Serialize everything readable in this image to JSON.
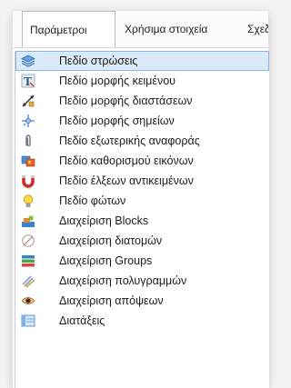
{
  "menubar": {
    "tabs": [
      {
        "label": "Παράμετροι"
      },
      {
        "label": "Χρήσιμα στοιχεία"
      },
      {
        "label": "Σχεδ"
      }
    ]
  },
  "dropdown": {
    "items": [
      {
        "label": "Πεδίο στρώσεις",
        "icon": "layers-icon",
        "selected": true
      },
      {
        "label": "Πεδίο μορφής κειμένου",
        "icon": "text-style-icon"
      },
      {
        "label": "Πεδίο μορφής διαστάσεων",
        "icon": "dimension-style-icon"
      },
      {
        "label": "Πεδίο μορφής σημείων",
        "icon": "point-style-icon"
      },
      {
        "label": "Πεδίο εξωτερικής αναφοράς",
        "icon": "paperclip-icon"
      },
      {
        "label": "Πεδίο καθορισμού εικόνων",
        "icon": "image-icon"
      },
      {
        "label": "Πεδίο έλξεων αντικειμένων",
        "icon": "magnet-icon"
      },
      {
        "label": "Πεδίο φώτων",
        "icon": "lightbulb-icon"
      },
      {
        "label": "Διαχείριση Blocks",
        "icon": "blocks-icon"
      },
      {
        "label": "Διαχείριση διατομών",
        "icon": "section-icon"
      },
      {
        "label": "Διαχείριση Groups",
        "icon": "groups-icon"
      },
      {
        "label": "Διαχείριση πολυγραμμών",
        "icon": "polyline-icon"
      },
      {
        "label": "Διαχείριση απόψεων",
        "icon": "eye-icon"
      },
      {
        "label": "Διατάξεις",
        "icon": "layouts-icon"
      }
    ]
  }
}
